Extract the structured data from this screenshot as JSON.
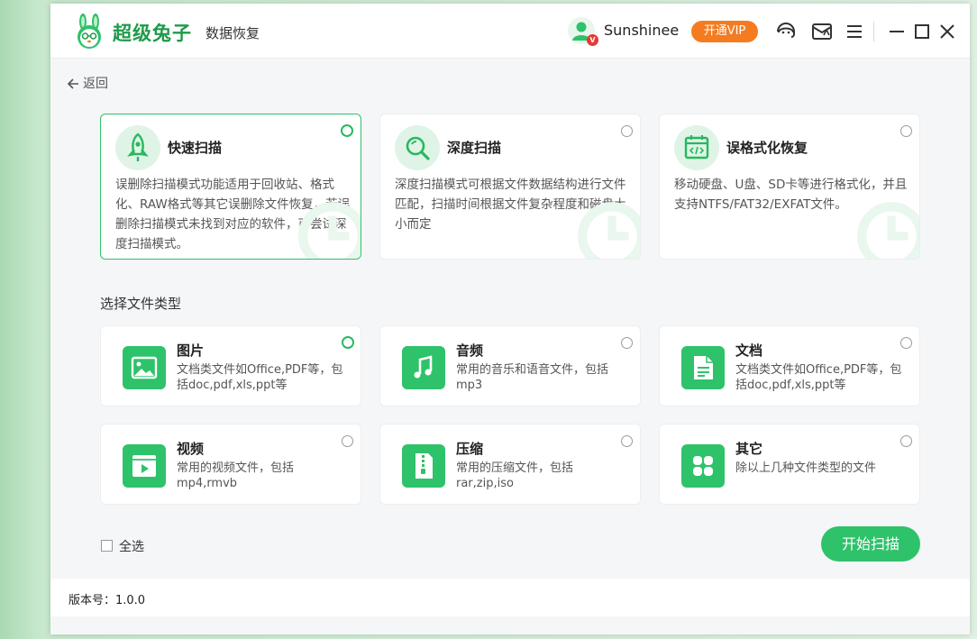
{
  "header": {
    "brand": "超级兔子",
    "product": "数据恢复",
    "username": "Sunshinee",
    "vip_badge": "V",
    "vip_button": "开通VIP"
  },
  "nav": {
    "back_label": "返回"
  },
  "scan_modes": [
    {
      "title": "快速扫描",
      "desc": "误删除扫描模式功能适用于回收站、格式化、RAW格式等其它误删除文件恢复，若误删除扫描模式未找到对应的软件，可尝试深度扫描模式。",
      "icon": "rocket-icon",
      "selected": true
    },
    {
      "title": "深度扫描",
      "desc": "深度扫描模式可根据文件数据结构进行文件匹配，扫描时间根据文件复杂程度和磁盘大小而定",
      "icon": "magnifier-icon",
      "selected": false
    },
    {
      "title": "误格式化恢复",
      "desc": "移动硬盘、U盘、SD卡等进行格式化，并且支持NTFS/FAT32/EXFAT文件。",
      "icon": "calendar-code-icon",
      "selected": false
    }
  ],
  "file_types_label": "选择文件类型",
  "file_types": [
    {
      "title": "图片",
      "desc": "文档类文件如Office,PDF等，包括doc,pdf,xls,ppt等",
      "icon": "image-icon",
      "selected": true
    },
    {
      "title": "音频",
      "desc": "常用的音乐和语音文件，包括mp3",
      "icon": "music-note-icon",
      "selected": false
    },
    {
      "title": "文档",
      "desc": "文档类文件如Office,PDF等，包括doc,pdf,xls,ppt等",
      "icon": "document-icon",
      "selected": false
    },
    {
      "title": "视频",
      "desc": "常用的视频文件，包括mp4,rmvb",
      "icon": "video-icon",
      "selected": false
    },
    {
      "title": "压缩",
      "desc": "常用的压缩文件，包括rar,zip,iso",
      "icon": "zip-icon",
      "selected": false
    },
    {
      "title": "其它",
      "desc": "除以上几种文件类型的文件",
      "icon": "four-leaf-icon",
      "selected": false
    }
  ],
  "select_all_label": "全选",
  "start_button": "开始扫描",
  "version_text": "版本号：1.0.0",
  "colors": {
    "accent": "#2ec26a",
    "vip": "#f47b20",
    "brand_text": "#1e9a4a"
  }
}
